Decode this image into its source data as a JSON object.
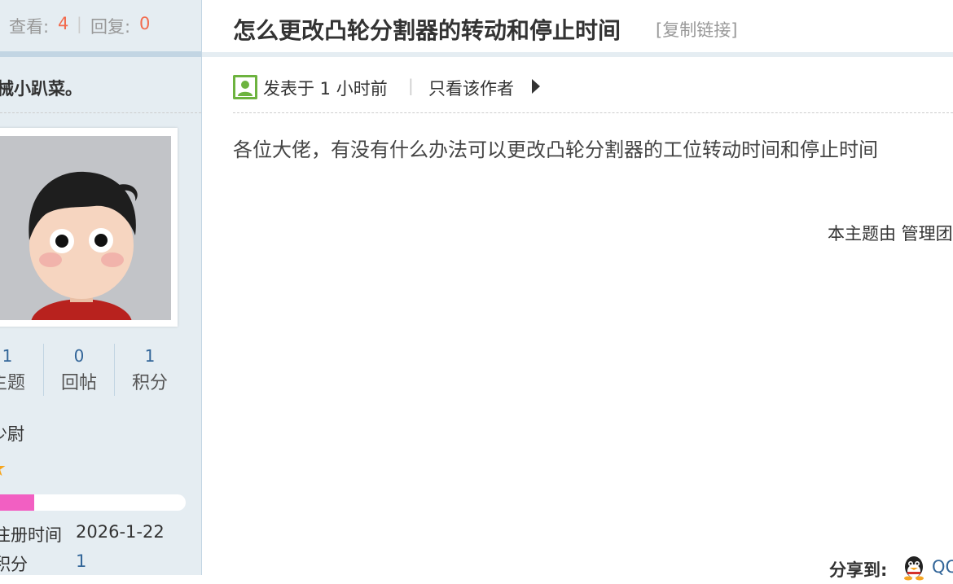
{
  "sidebar": {
    "views_label": "查看:",
    "views_value": "4",
    "replies_label": "回复:",
    "replies_value": "0",
    "author_name": "械小趴菜。",
    "stats": [
      {
        "value": "1",
        "label": "主题"
      },
      {
        "value": "0",
        "label": "回帖"
      },
      {
        "value": "1",
        "label": "积分"
      }
    ],
    "rank_title": "少尉",
    "level_progress_fraction": 0.22,
    "info": [
      {
        "label": "注册时间",
        "value": "2026-1-22"
      },
      {
        "label": "积分",
        "value": "1"
      }
    ]
  },
  "thread": {
    "title": "怎么更改凸轮分割器的转动和停止时间",
    "copy_link": "[复制链接]",
    "post_meta": "发表于 1 小时前",
    "meta_separator": "|",
    "only_author": "只看该作者",
    "body": "各位大佬，有没有什么办法可以更改凸轮分割器的工位转动时间和停止时间",
    "manage_note": "本主题由 管理团",
    "share_label": "分享到:",
    "share_qq": "QQ"
  },
  "colors": {
    "sidebar_bg": "#e5edf2",
    "accent_link": "#336699",
    "count_highlight": "#f26c4f",
    "level_fill": "#f25fc2",
    "star": "#f7a51c"
  },
  "icons": [
    "user-avatar-icon",
    "poster-icon",
    "arrow-right-icon",
    "star-icon",
    "qq-icon"
  ]
}
